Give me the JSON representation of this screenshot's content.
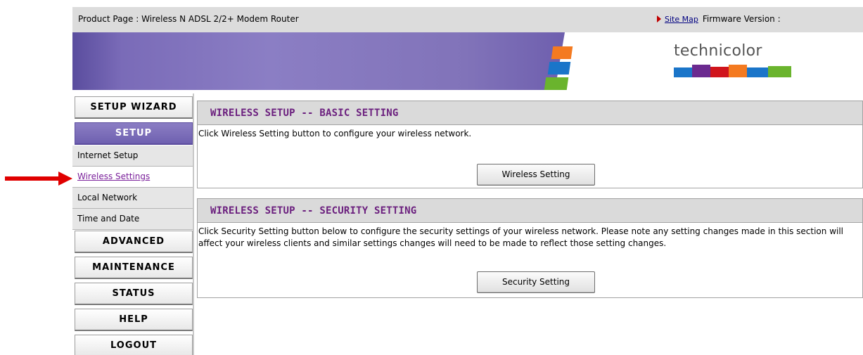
{
  "topbar": {
    "product_text": "Product Page : Wireless N ADSL 2/2+ Modem Router",
    "site_map": "Site Map",
    "firmware": "Firmware Version :"
  },
  "banner": {
    "logo_text": "technicolor"
  },
  "sidebar": {
    "setup_wizard": "SETUP WIZARD",
    "setup": "SETUP",
    "items": [
      {
        "label": "Internet Setup"
      },
      {
        "label": "Wireless Settings"
      },
      {
        "label": "Local Network"
      },
      {
        "label": "Time and Date"
      }
    ],
    "advanced": "ADVANCED",
    "maintenance": "MAINTENANCE",
    "status": "STATUS",
    "help": "HELP",
    "logout": "LOGOUT"
  },
  "basic": {
    "title": "WIRELESS SETUP -- BASIC SETTING",
    "desc": "Click Wireless Setting button to configure your wireless network.",
    "button": "Wireless Setting"
  },
  "security": {
    "title": "WIRELESS SETUP -- SECURITY SETTING",
    "desc": "Click Security Setting button below to configure the security settings of your wireless network. Please note any setting changes made in this section will affect your wireless clients and similar settings changes will need to be made to reflect those setting changes.",
    "button": "Security Setting"
  },
  "colors": {
    "accent_purple": "#7a6bb8",
    "header_text": "#6b1f7e",
    "arrow_red": "#e00000"
  }
}
